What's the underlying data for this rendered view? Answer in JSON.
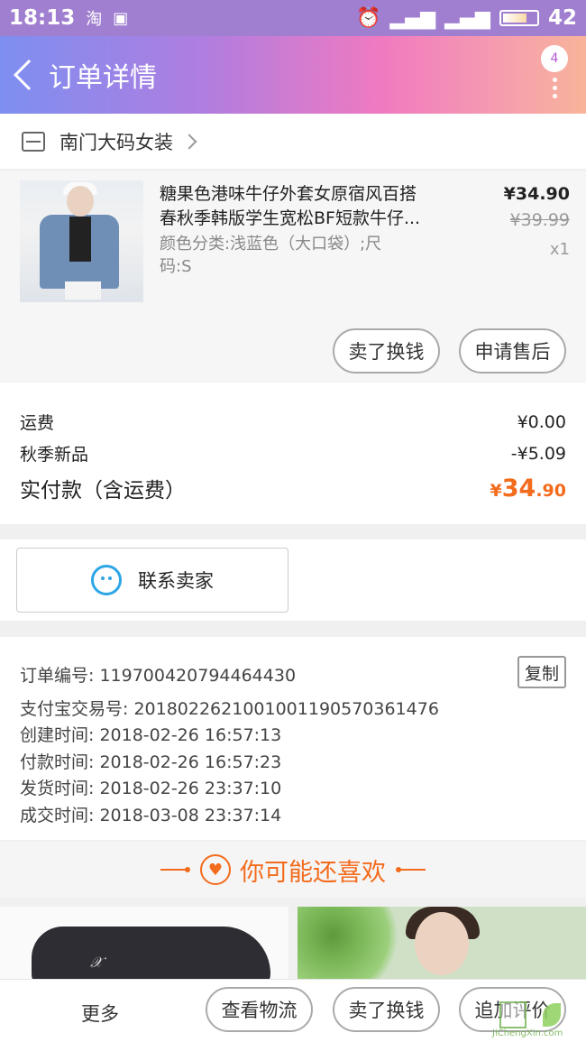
{
  "status_bar": {
    "time": "18:13",
    "app_icon": "淘",
    "battery": "42"
  },
  "header": {
    "title": "订单详情",
    "badge": "4"
  },
  "shop": {
    "name": "南门大码女装"
  },
  "product": {
    "title_line1": "糖果色港味牛仔外套女原宿风百搭",
    "title_line2": "春秋季韩版学生宽松BF短款牛仔...",
    "spec_line1": "颜色分类:浅蓝色（大口袋）;尺",
    "spec_line2": "码:S",
    "price": "¥34.90",
    "original_price": "¥39.99",
    "quantity": "x1",
    "btn_resell": "卖了换钱",
    "btn_after_sale": "申请售后"
  },
  "costs": {
    "shipping_label": "运费",
    "shipping_value": "¥0.00",
    "discount_label": "秋季新品",
    "discount_value": "-¥5.09",
    "total_label": "实付款（含运费）",
    "total_symbol": "¥",
    "total_integer": "34",
    "total_decimal": ".90"
  },
  "contact": {
    "label": "联系卖家"
  },
  "order_info": {
    "order_no": "订单编号: 119700420794464430",
    "alipay_no": "支付宝交易号: 2018022621001001190570361476",
    "created": "创建时间: 2018-02-26 16:57:13",
    "paid": "付款时间: 2018-02-26 16:57:23",
    "shipped": "发货时间: 2018-02-26 23:37:10",
    "completed": "成交时间: 2018-03-08 23:37:14",
    "copy": "复制"
  },
  "recommend": {
    "title": "你可能还喜欢"
  },
  "bottom_bar": {
    "more": "更多",
    "logistics": "查看物流",
    "resell": "卖了换钱",
    "review": "追加评价"
  },
  "watermark": {
    "text": "JiChengXin.com"
  },
  "colors": {
    "accent": "#f36b1c",
    "header_start": "#7d8ff0",
    "header_end": "#f8b49a",
    "link_blue": "#2da6e6"
  }
}
